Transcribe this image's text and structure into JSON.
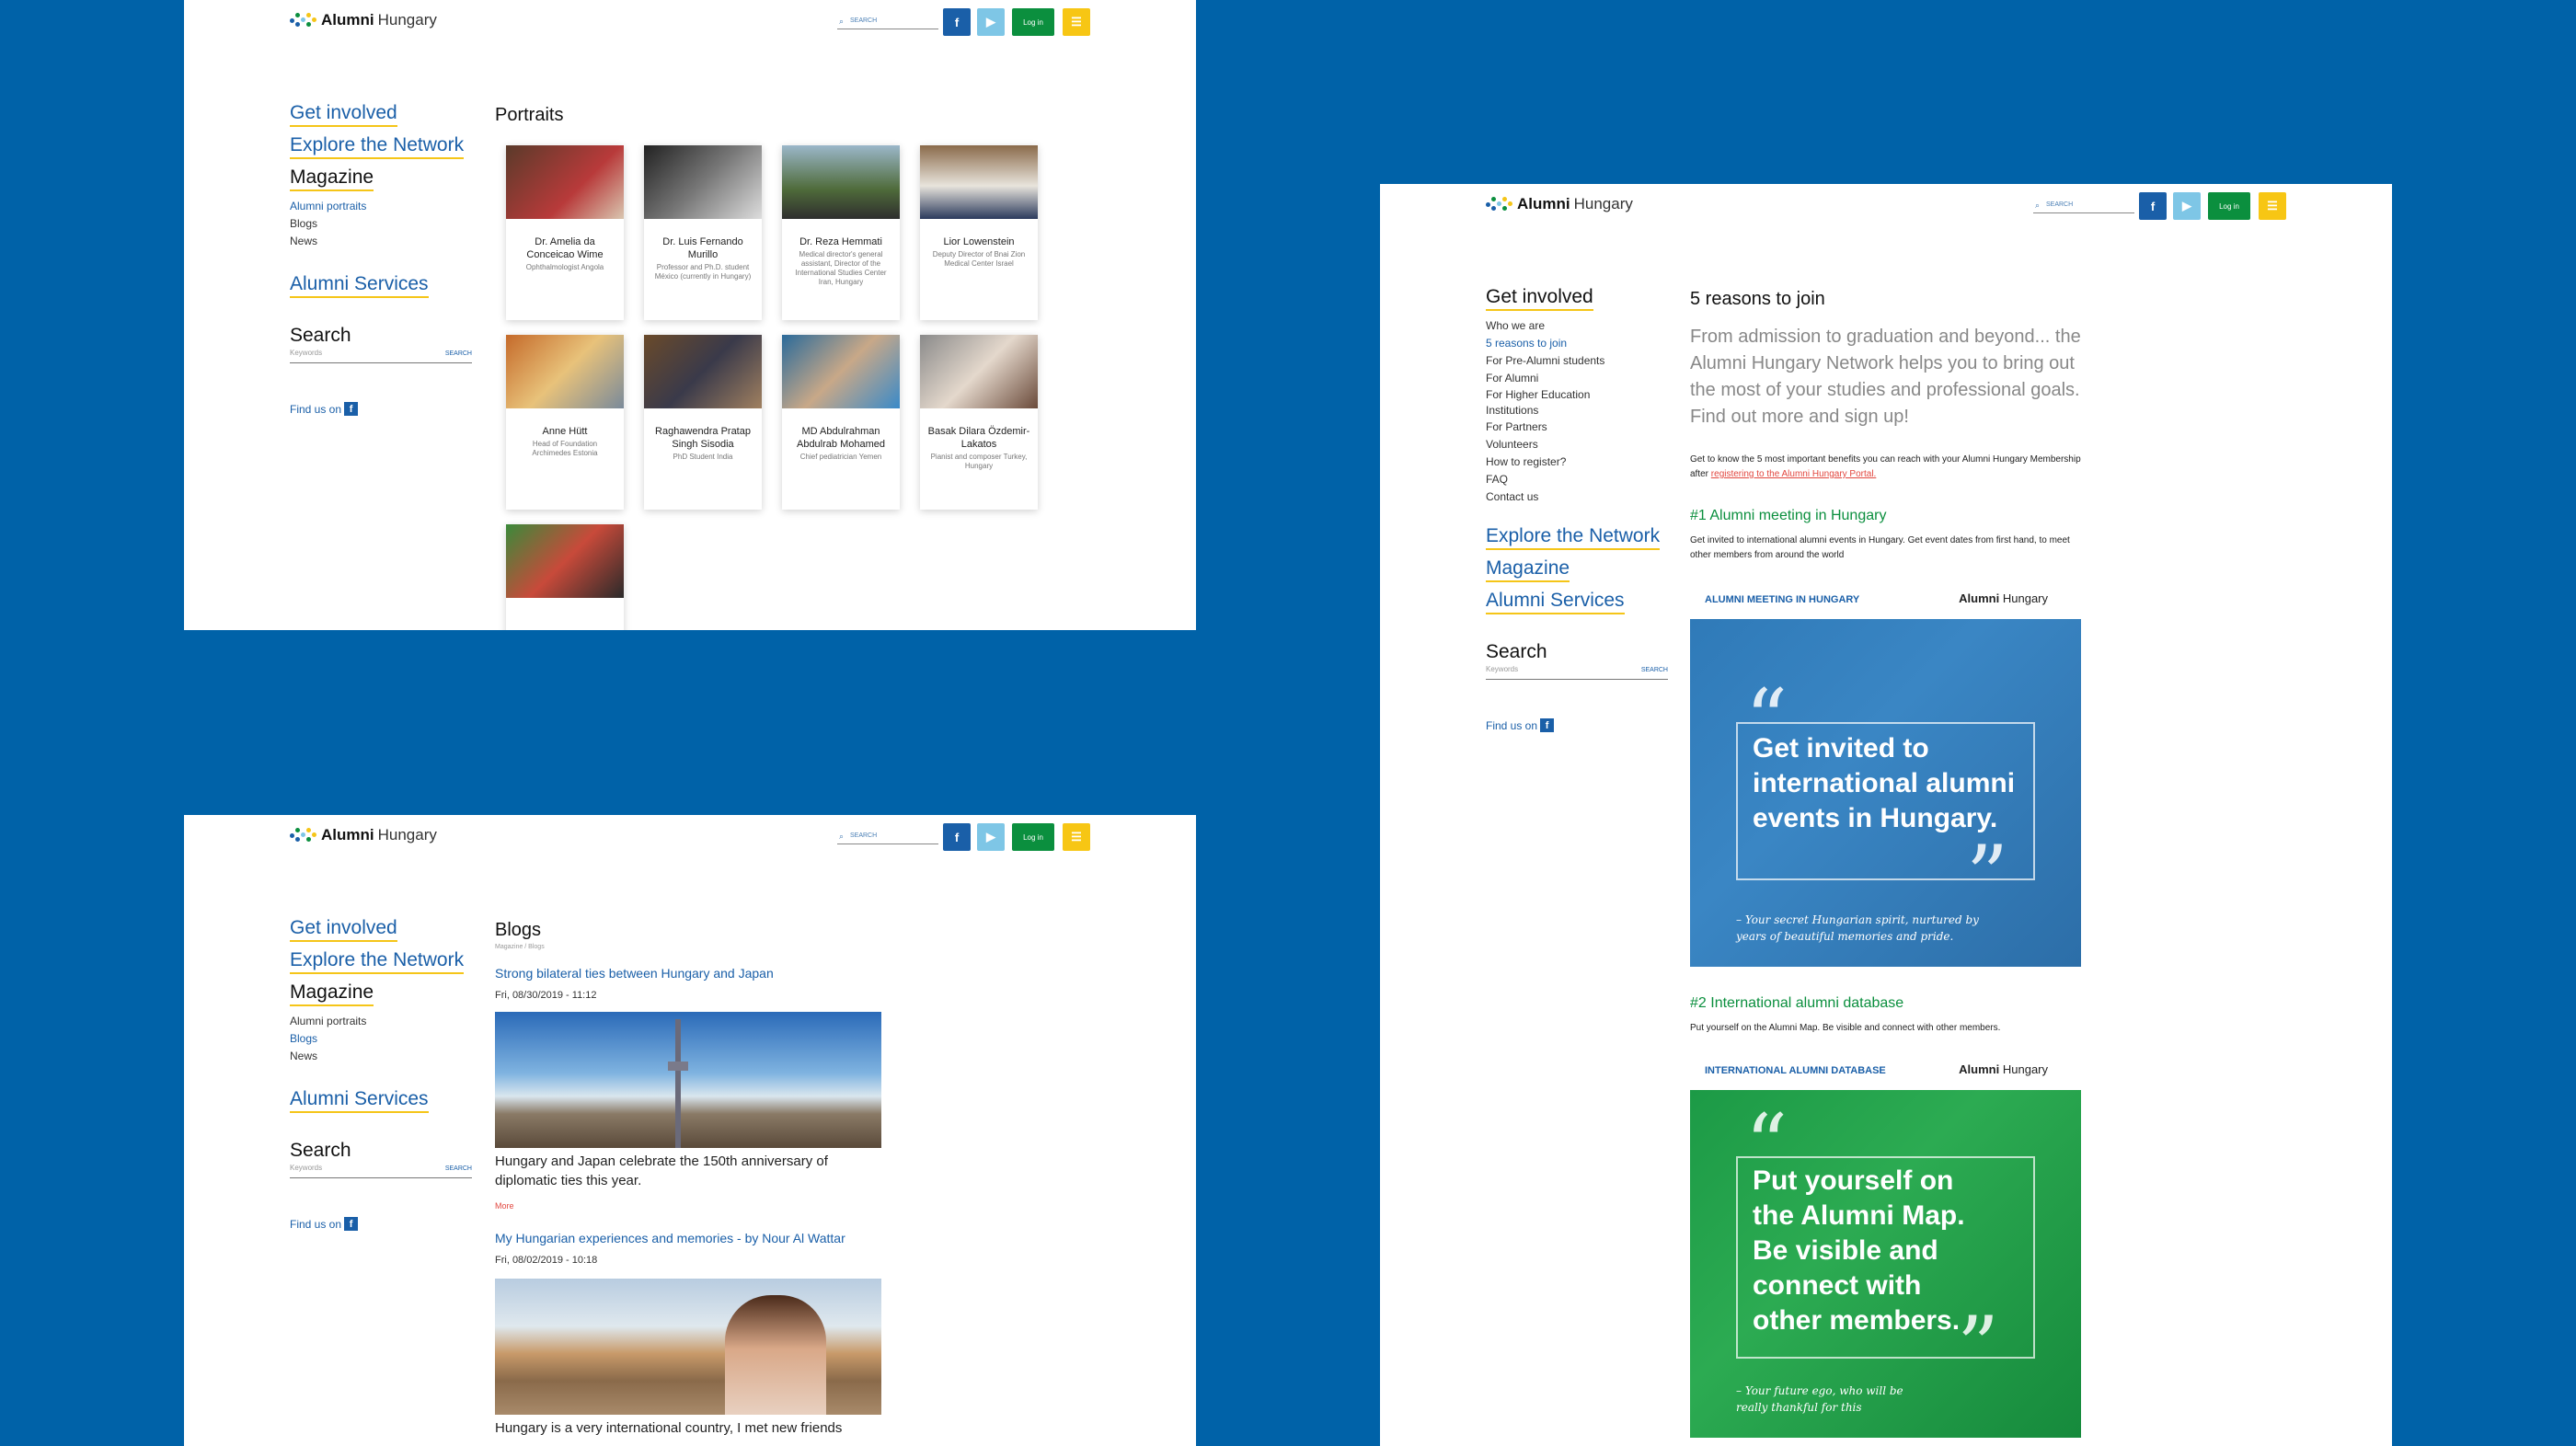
{
  "colors": {
    "background": "#0062a8",
    "accent_blue": "#1a5fa8",
    "accent_green": "#0b8f3e",
    "accent_yellow": "#f5c518",
    "link_red": "#e2473f"
  },
  "header": {
    "brand_bold": "Alumni",
    "brand_light": "Hungary",
    "search_placeholder": "SEARCH",
    "facebook_icon": "f",
    "youtube_icon": "▶",
    "login_label": "Log in",
    "menu_icon": "menu-icon"
  },
  "nav": {
    "get_involved": "Get involved",
    "explore": "Explore the Network",
    "magazine": "Magazine",
    "alumni_services": "Alumni Services",
    "search_label": "Search",
    "keywords_placeholder": "Keywords",
    "search_button": "SEARCH",
    "find_us": "Find us on",
    "fb_glyph": "f"
  },
  "magazine_sub": [
    "Alumni portraits",
    "Blogs",
    "News"
  ],
  "portraits": {
    "title": "Portraits",
    "cards": [
      {
        "name": "Dr. Amelia da Conceicao Wime",
        "desc": "Ophthalmologist Angola"
      },
      {
        "name": "Dr. Luis Fernando Murillo",
        "desc": "Professor and Ph.D. student México (currently in Hungary)"
      },
      {
        "name": "Dr. Reza Hemmati",
        "desc": "Medical director's general assistant, Director of the International Studies Center Iran, Hungary"
      },
      {
        "name": "Lior Lowenstein",
        "desc": "Deputy Director of Bnai Zion Medical Center Israel"
      },
      {
        "name": "Anne Hütt",
        "desc": "Head of Foundation Archimedes Estonia"
      },
      {
        "name": "Raghawendra Pratap Singh Sisodia",
        "desc": "PhD Student India"
      },
      {
        "name": "MD Abdulrahman Abdulrab Mohamed",
        "desc": "Chief pediatrician Yemen"
      },
      {
        "name": "Basak Dilara Özdemir-Lakatos",
        "desc": "Pianist and composer Turkey, Hungary"
      },
      {
        "name": "",
        "desc": ""
      }
    ]
  },
  "blogs": {
    "title": "Blogs",
    "breadcrumb": "Magazine / Blogs",
    "posts": [
      {
        "title": "Strong bilateral ties between Hungary and Japan",
        "date": "Fri, 08/30/2019 - 11:12",
        "text": "Hungary and Japan celebrate the 150th anniversary of diplomatic ties this year.",
        "more": "More"
      },
      {
        "title": "My Hungarian experiences and memories - by Nour Al Wattar",
        "date": "Fri, 08/02/2019 - 10:18",
        "text": "Hungary is a very international country, I met new friends"
      }
    ]
  },
  "involved_sub": [
    "Who we are",
    "5 reasons to join",
    "For Pre-Alumni students",
    "For Alumni",
    "For Higher Education Institutions",
    "For Partners",
    "Volunteers",
    "How to register?",
    "FAQ",
    "Contact us"
  ],
  "reasons": {
    "title": "5 reasons to join",
    "intro": "From admission to graduation and beyond... the Alumni Hungary Network helps you to bring out the most of your studies and professional goals. Find out more and sign up!",
    "lead": "Get to know the 5 most important benefits you can reach with your Alumni Hungary Membership after",
    "lead_link": "registering to the Alumni Hungary Portal.",
    "r1_title": "#1 Alumni meeting in Hungary",
    "r1_text": "Get invited to international alumni events in Hungary. Get event dates from first hand, to meet other members from around the world",
    "r1_banner": "ALUMNI MEETING IN HUNGARY",
    "r1_big": "Get invited to international alumni events in Hungary.",
    "r1_quote": "– Your secret Hungarian spirit, nurtured by years of beautiful memories and pride.",
    "r2_title": "#2 International alumni database",
    "r2_text": "Put yourself on the Alumni Map. Be visible and connect with other members.",
    "r2_banner": "INTERNATIONAL ALUMNI DATABASE",
    "r2_big": "Put yourself on the Alumni Map. Be visible and connect with other members.",
    "r2_quote": "– Your future ego, who will be really thankful for this"
  }
}
